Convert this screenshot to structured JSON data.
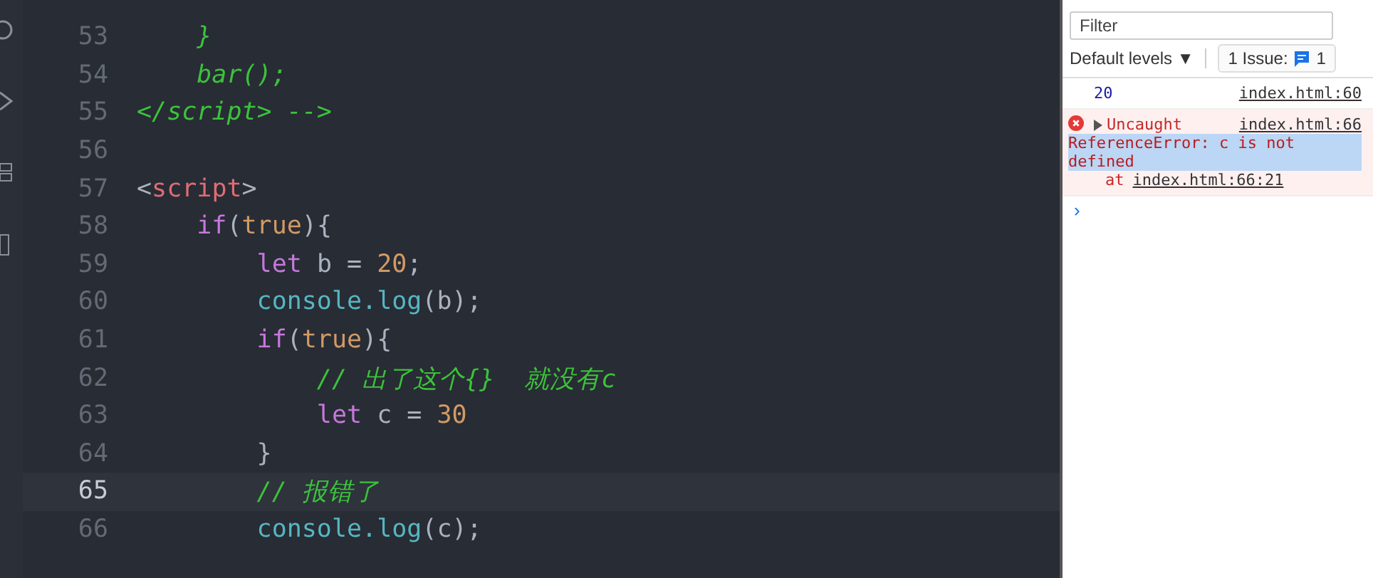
{
  "editor": {
    "lines": [
      {
        "number": "53",
        "current": false,
        "tokens": [
          {
            "kind": "comment",
            "text": "    }"
          }
        ]
      },
      {
        "number": "54",
        "current": false,
        "tokens": [
          {
            "kind": "comment",
            "text": "    bar();"
          }
        ]
      },
      {
        "number": "55",
        "current": false,
        "tokens": [
          {
            "kind": "comment",
            "text": "</script> -->"
          }
        ]
      },
      {
        "number": "56",
        "current": false
      },
      {
        "number": "57",
        "current": false,
        "tokens": [
          {
            "kind": "punct",
            "text": "<"
          },
          {
            "kind": "tag",
            "text": "script"
          },
          {
            "kind": "punct",
            "text": ">"
          }
        ]
      },
      {
        "number": "58",
        "current": false,
        "tokens": [
          {
            "kind": "keyword",
            "text": "    if"
          },
          {
            "kind": "punct",
            "text": "("
          },
          {
            "kind": "literal",
            "text": "true"
          },
          {
            "kind": "punct",
            "text": "){"
          }
        ]
      },
      {
        "number": "59",
        "current": false,
        "tokens": [
          {
            "kind": "keyword",
            "text": "        let"
          },
          {
            "kind": "plain",
            "text": " b = "
          },
          {
            "kind": "literal",
            "text": "20"
          },
          {
            "kind": "punct",
            "text": ";"
          }
        ]
      },
      {
        "number": "60",
        "current": false,
        "tokens": [
          {
            "kind": "func",
            "text": "        console.log"
          },
          {
            "kind": "punct",
            "text": "(b);"
          }
        ]
      },
      {
        "number": "61",
        "current": false,
        "tokens": [
          {
            "kind": "keyword",
            "text": "        if"
          },
          {
            "kind": "punct",
            "text": "("
          },
          {
            "kind": "literal",
            "text": "true"
          },
          {
            "kind": "punct",
            "text": "){"
          }
        ]
      },
      {
        "number": "62",
        "current": false,
        "tokens": [
          {
            "kind": "comment",
            "text": "            // 出了这个{}  就没有c"
          }
        ]
      },
      {
        "number": "63",
        "current": false,
        "tokens": [
          {
            "kind": "keyword",
            "text": "            let"
          },
          {
            "kind": "plain",
            "text": " c = "
          },
          {
            "kind": "literal",
            "text": "30"
          }
        ]
      },
      {
        "number": "64",
        "current": false,
        "tokens": [
          {
            "kind": "punct",
            "text": "        }"
          }
        ]
      },
      {
        "number": "65",
        "current": true,
        "tokens": [
          {
            "kind": "comment",
            "text": "        // 报错了"
          }
        ]
      },
      {
        "number": "66",
        "current": false,
        "tokens": [
          {
            "kind": "func",
            "text": "        console.log"
          },
          {
            "kind": "punct",
            "text": "(c);"
          }
        ]
      }
    ]
  },
  "console": {
    "filter": {
      "placeholder": "Filter"
    },
    "levels": "Default levels ▼",
    "issues": {
      "label": "1 Issue:",
      "count": "1"
    },
    "messages": [
      {
        "kind": "log",
        "text": "20",
        "source": "index.html:60"
      },
      {
        "kind": "error",
        "summary": "Uncaught",
        "source": "index.html:66",
        "detail": "ReferenceError: c is not defined",
        "at": "at",
        "location": "index.html:66:21"
      }
    ],
    "prompt": "›"
  }
}
